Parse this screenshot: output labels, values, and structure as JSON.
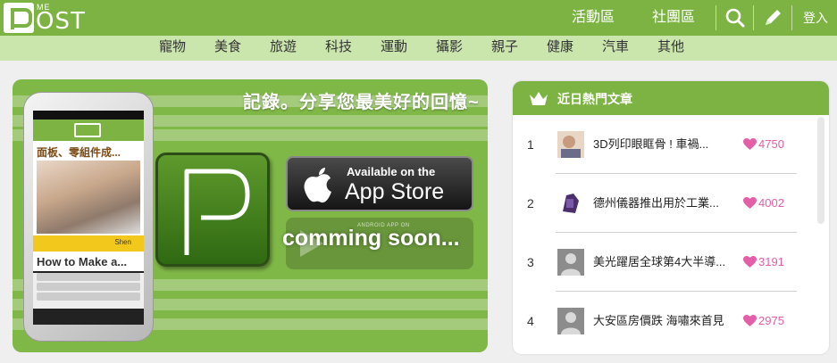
{
  "header": {
    "logo_small": "ME",
    "logo_text": "OST",
    "nav_activity": "活動區",
    "nav_community": "社團區",
    "login": "登入",
    "icons": [
      "search-icon",
      "pencil-icon"
    ]
  },
  "categories": [
    "寵物",
    "美食",
    "旅遊",
    "科技",
    "運動",
    "攝影",
    "親子",
    "健康",
    "汽車",
    "其他"
  ],
  "banner": {
    "slogan": "記錄。分享您最美好的回憶~",
    "phone_article_title": "面板、零組件成...",
    "phone_author": "Shen",
    "phone_article_title2": "How to Make a...",
    "appstore_small": "Available on the",
    "appstore_big": "App Store",
    "android_small": "ANDROID APP ON",
    "android_status": "comming soon..."
  },
  "hot": {
    "title": "近日熱門文章",
    "items": [
      {
        "rank": "1",
        "title": "3D列印眼眶骨 ! 車禍...",
        "likes": "4750"
      },
      {
        "rank": "2",
        "title": "德州儀器推出用於工業...",
        "likes": "4002"
      },
      {
        "rank": "3",
        "title": "美光躍居全球第4大半導...",
        "likes": "3191"
      },
      {
        "rank": "4",
        "title": "大安區房價跌 海嘯來首見",
        "likes": "2975"
      }
    ]
  },
  "colors": {
    "brand_green": "#7cb342",
    "category_bg": "#cbe6ad",
    "like_pink": "#e35fa7"
  }
}
